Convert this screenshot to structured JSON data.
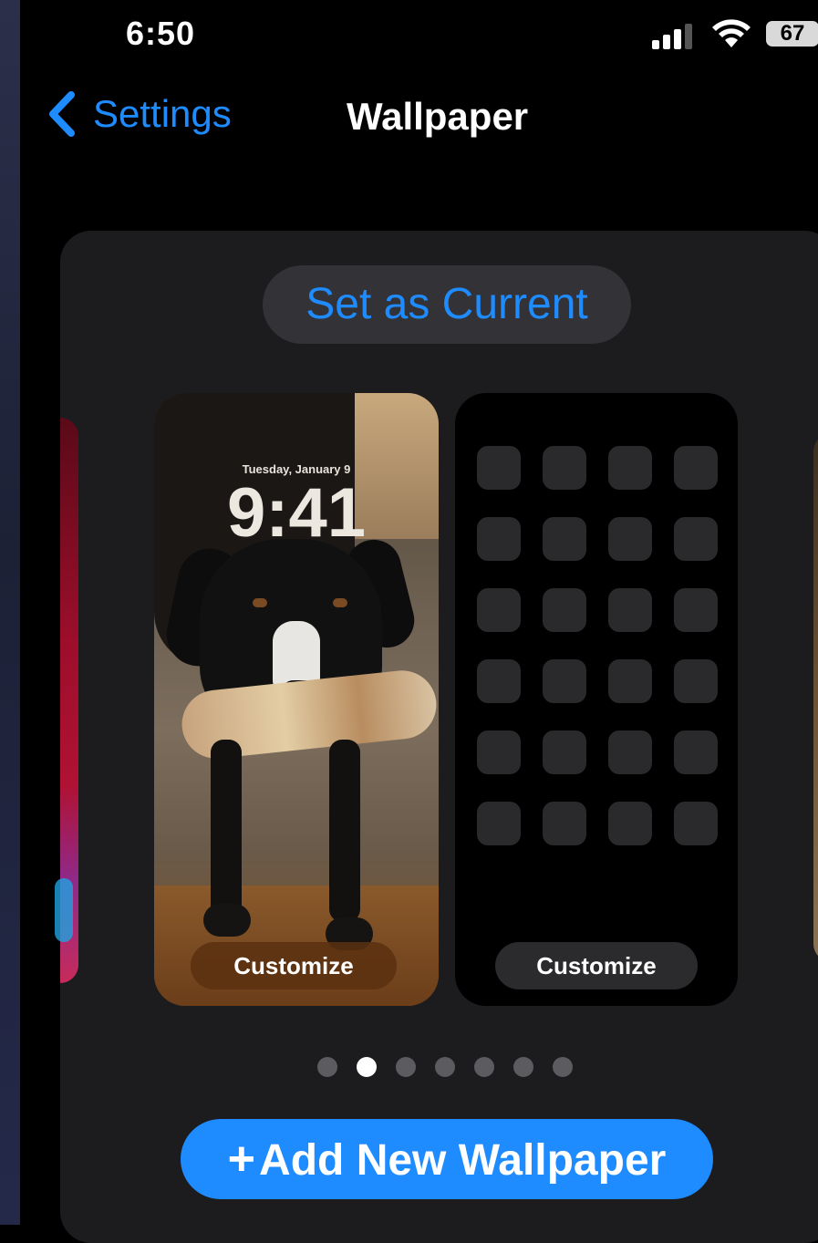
{
  "status_bar": {
    "time": "6:50",
    "battery": "67"
  },
  "nav": {
    "back_label": "Settings",
    "title": "Wallpaper"
  },
  "card": {
    "set_current_label": "Set as Current",
    "lock_preview": {
      "date": "Tuesday, January 9",
      "time": "9:41",
      "customize_label": "Customize"
    },
    "home_preview": {
      "customize_label": "Customize",
      "app_rows": 6,
      "app_cols": 4
    },
    "page_indicator": {
      "count": 7,
      "active_index": 1
    },
    "add_button": {
      "icon": "+",
      "label": "Add New Wallpaper"
    }
  },
  "colors": {
    "accent": "#1e8bff",
    "card_bg": "#1c1c1e"
  }
}
